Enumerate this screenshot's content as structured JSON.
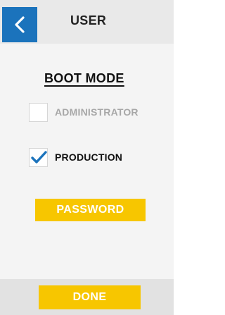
{
  "header": {
    "title": "USER",
    "back_icon": "chevron-left-icon"
  },
  "boot_mode": {
    "title": "BOOT MODE",
    "options": [
      {
        "label": "ADMINISTRATOR",
        "checked": false,
        "disabled": true
      },
      {
        "label": "PRODUCTION",
        "checked": true,
        "disabled": false
      }
    ]
  },
  "actions": {
    "password_label": "PASSWORD",
    "done_label": "DONE"
  },
  "colors": {
    "accent_blue": "#1b73bc",
    "button_yellow": "#f7c600",
    "background": "#f4f4f4",
    "header_background": "#e9e9e9",
    "footer_background": "#e2e2e2",
    "disabled_text": "#a7a7a7"
  }
}
